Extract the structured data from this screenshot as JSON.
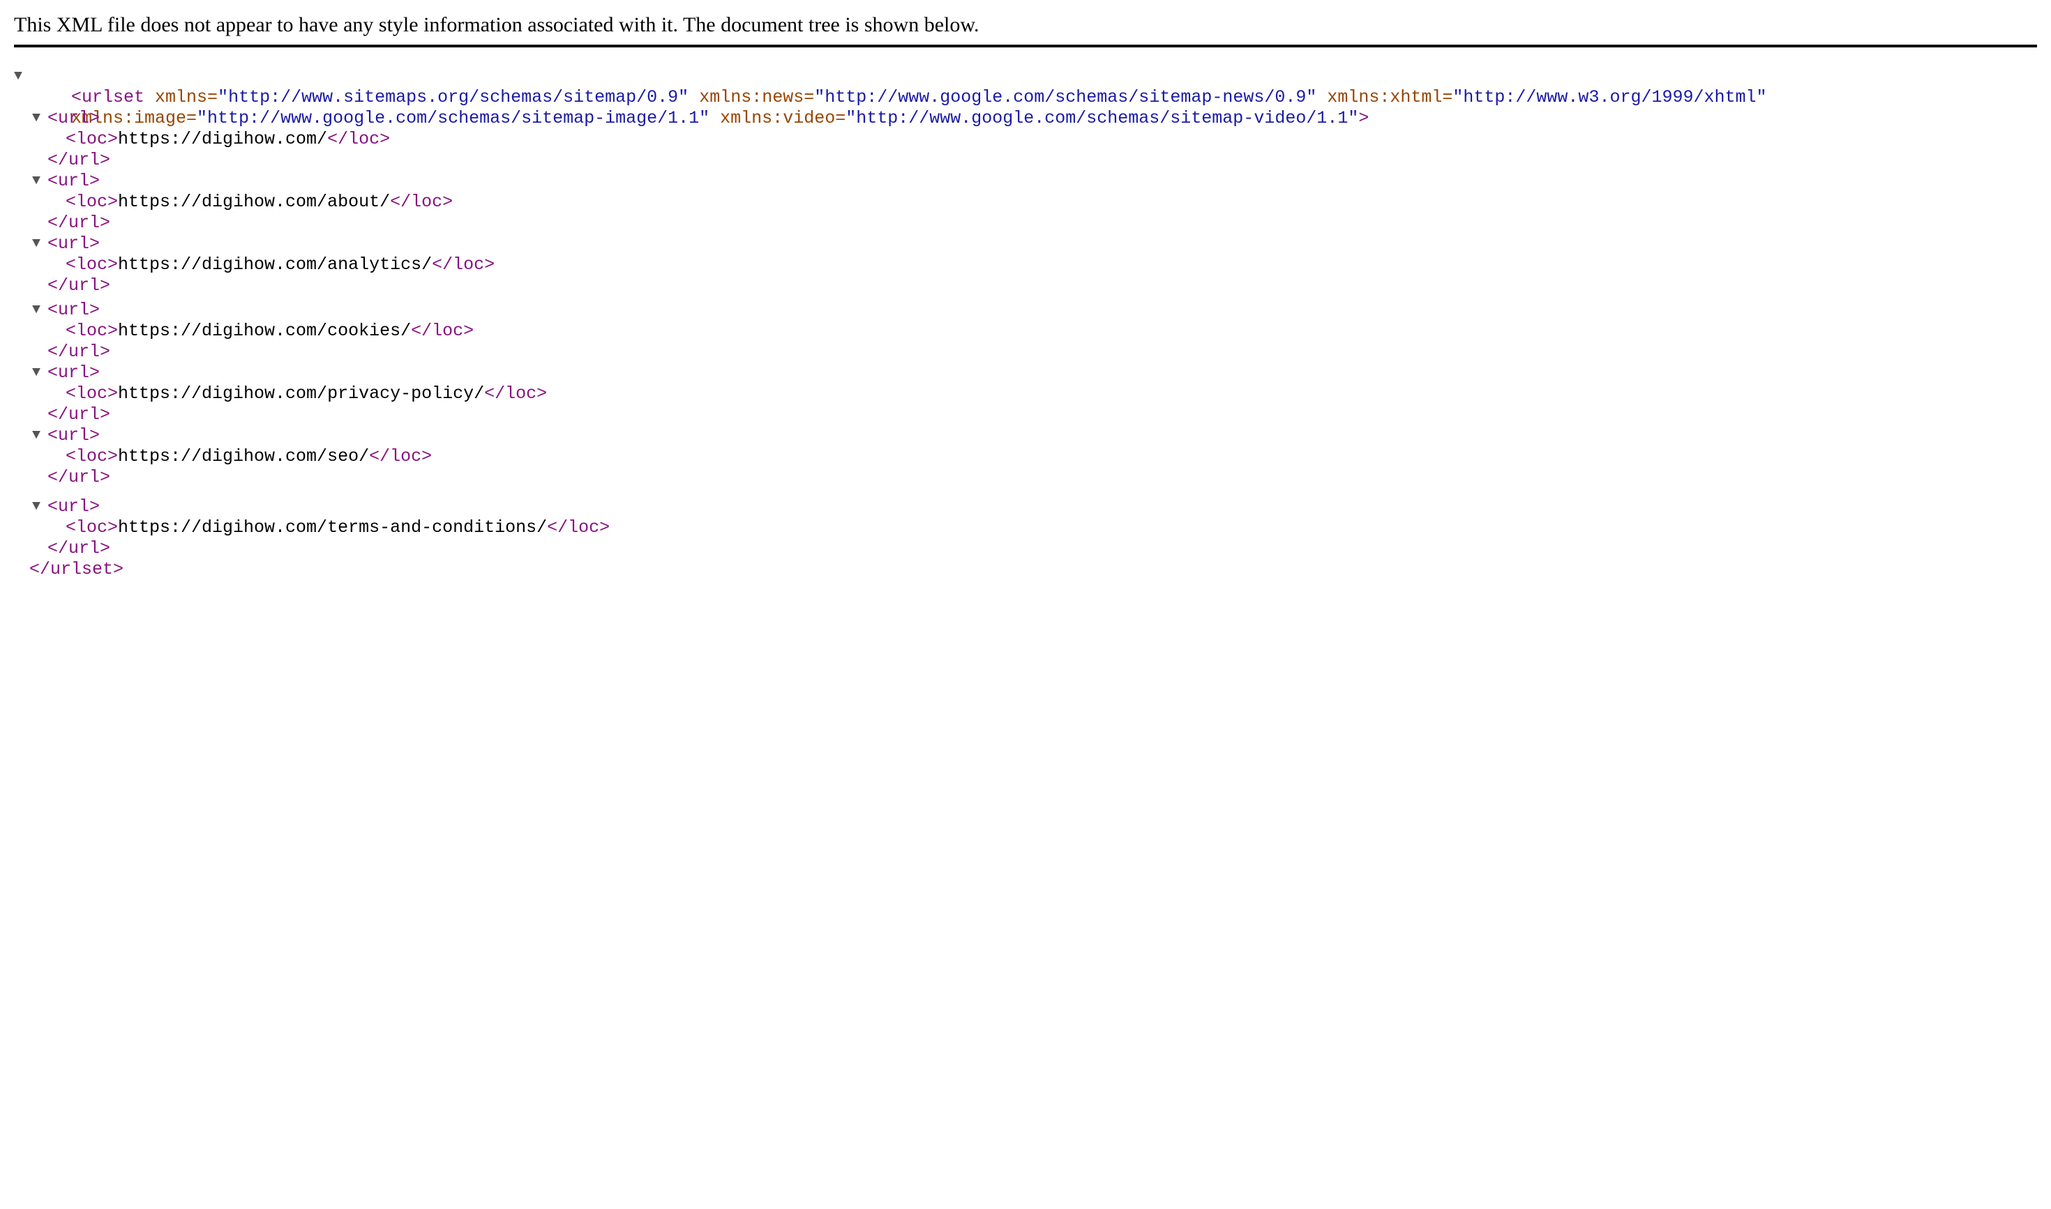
{
  "header": {
    "message": "This XML file does not appear to have any style information associated with it. The document tree is shown below."
  },
  "colors": {
    "tag": "#881280",
    "attr_name": "#994500",
    "attr_value": "#1a1aa6",
    "text": "#000000",
    "toggle": "#555555",
    "rule": "#000000"
  },
  "icons": {
    "toggle": "triangle-down-icon",
    "toggle_glyph": "▼"
  },
  "root": {
    "open_start": "<urlset",
    "attrs": [
      {
        "name": " xmlns=",
        "value": "\"http://www.sitemaps.org/schemas/sitemap/0.9\""
      },
      {
        "name": " xmlns:news=",
        "value": "\"http://www.google.com/schemas/sitemap-news/0.9\""
      },
      {
        "name": " xmlns:xhtml=",
        "value": "\"http://www.w3.org/1999/xhtml\""
      },
      {
        "name": "xmlns:image=",
        "value": "\"http://www.google.com/schemas/sitemap-image/1.1\""
      },
      {
        "name": " xmlns:video=",
        "value": "\"http://www.google.com/schemas/sitemap-video/1.1\""
      }
    ],
    "open_end": ">",
    "close": "</urlset>"
  },
  "url_tags": {
    "open": "<url>",
    "close": "</url>",
    "loc_open": "<loc>",
    "loc_close": "</loc>"
  },
  "urls": [
    "https://digihow.com/",
    "https://digihow.com/about/",
    "https://digihow.com/analytics/",
    "https://digihow.com/cookies/",
    "https://digihow.com/privacy-policy/",
    "https://digihow.com/seo/",
    "https://digihow.com/terms-and-conditions/"
  ]
}
